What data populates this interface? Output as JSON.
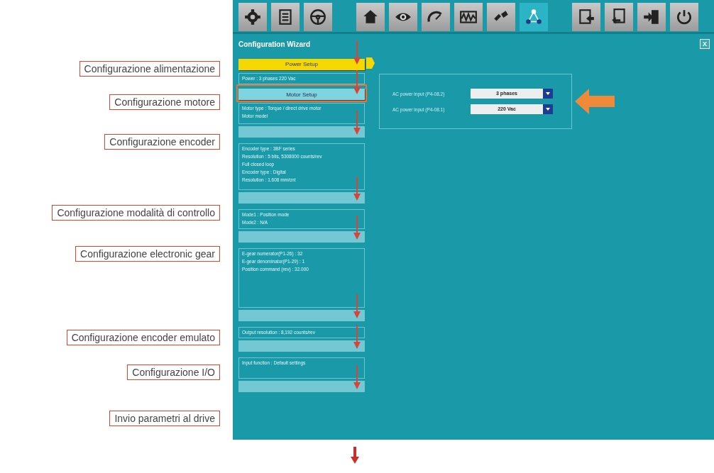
{
  "annotations": [
    "Configurazione alimentazione",
    "Configurazione motore",
    "Configurazione encoder",
    "Configurazione modalità di controllo",
    "Configurazione electronic gear",
    "Configurazione encoder emulato",
    "Configurazione I/O",
    "Invio parametri al drive"
  ],
  "toolbar": [
    {
      "selected": false
    },
    {
      "selected": false
    },
    {
      "selected": false
    },
    {
      "selected": false
    },
    {
      "selected": false
    },
    {
      "selected": false
    },
    {
      "selected": false
    },
    {
      "selected": false
    },
    {
      "selected": true
    },
    {
      "selected": false
    },
    {
      "selected": false
    },
    {
      "selected": false
    },
    {
      "selected": false
    }
  ],
  "window": {
    "title": "Configuration Wizard",
    "close": "X"
  },
  "steps": [
    {
      "label": "Power Setup",
      "active": true,
      "disabled": false,
      "highlighted": false,
      "info": [
        "Power : 3 phases 220 Vac"
      ]
    },
    {
      "label": "Motor Setup",
      "active": false,
      "disabled": false,
      "highlighted": true,
      "info": [
        "Motor type : Torque / direct drive motor",
        "Motor model"
      ]
    },
    {
      "active": false,
      "disabled": true,
      "highlighted": false,
      "info": [
        "Encoder type : 3BF series",
        "Resolution : 5 bits, 5308000 counts/rev",
        "Full closed loop",
        "Encoder type : Digital",
        "Resolution : 1.608 mm/cnt"
      ]
    },
    {
      "active": false,
      "disabled": true,
      "highlighted": false,
      "info": [
        "Mode1 : Position mode",
        "Mode2 : N/A"
      ]
    },
    {
      "active": false,
      "disabled": true,
      "highlighted": false,
      "info": [
        "E-gear numerator(P1-26) : 32",
        "E-gear denominator(P1-29) : 1",
        "Position command (rev) : 32.000"
      ]
    },
    {
      "active": false,
      "disabled": true,
      "highlighted": false,
      "info": [
        "Output resolution : 8,192 counts/rev"
      ]
    },
    {
      "active": false,
      "disabled": true,
      "highlighted": false,
      "info": [
        "Input function : Default settings"
      ]
    },
    {
      "active": false,
      "disabled": true,
      "highlighted": false
    }
  ],
  "settings": [
    {
      "label": "AC power input (P4-08.2)",
      "value": "3 phases"
    },
    {
      "label": "AC power input (P4-08.1)",
      "value": "220 Vac"
    }
  ]
}
